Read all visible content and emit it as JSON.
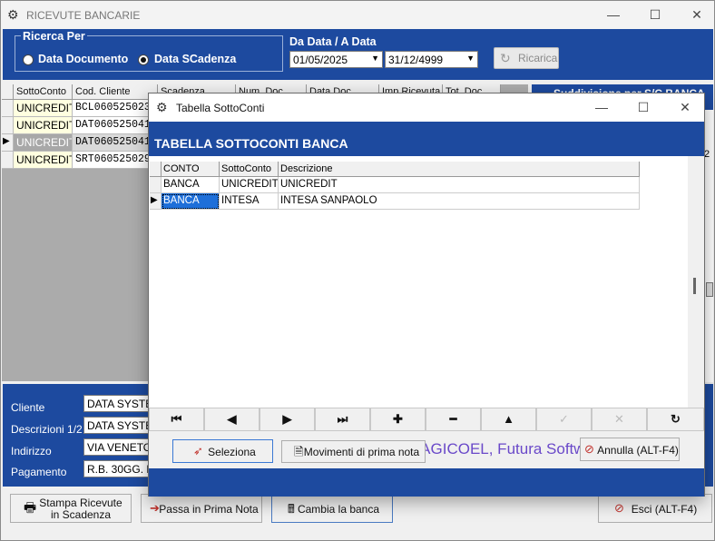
{
  "main": {
    "title": "RICEVUTE BANCARIE",
    "search": {
      "group_label": "Ricerca Per",
      "radio_documento": "Data Documento",
      "radio_scadenza": "Data SCadenza",
      "date_label": "Da Data / A Data",
      "date_from": "01/05/2025",
      "date_to": "31/12/4999",
      "reload_button": "Ricarica"
    },
    "grid": {
      "headers": [
        "SottoConto",
        "Cod. Cliente",
        "Scadenza",
        "Num. Doc.",
        "Data Doc.",
        "Imp.Ricevuta",
        "Tot. Doc."
      ],
      "rows": [
        {
          "sottoconto": "UNICREDIT",
          "cod": "BCL0605250232"
        },
        {
          "sottoconto": "UNICREDIT",
          "cod": "DAT060525041"
        },
        {
          "sottoconto": "UNICREDIT",
          "cod": "DAT060525041"
        },
        {
          "sottoconto": "UNICREDIT",
          "cod": "SRT060525029"
        }
      ]
    },
    "right_header": "Suddivisione per S/C BANCA",
    "right_cell": "2",
    "details": {
      "cliente_label": "Cliente",
      "cliente_value": "DATA SYSTE",
      "descr_label": "Descrizioni 1/2",
      "descr_value": "DATA SYSTE",
      "indirizzo_label": "Indirizzo",
      "indirizzo_value": "VIA VENETO,",
      "pagamento_label": "Pagamento",
      "pagamento_value": "R.B. 30GG. D"
    },
    "buttons": {
      "stampa_line1": "Stampa Ricevute",
      "stampa_line2": "in Scadenza",
      "passa": "Passa in Prima Nota",
      "cambia": "Cambia la banca",
      "esci": "Esci (ALT-F4)"
    }
  },
  "dialog": {
    "title": "Tabella SottoConti",
    "header": "TABELLA SOTTOCONTI BANCA",
    "columns": [
      "CONTO",
      "SottoConto",
      "Descrizione"
    ],
    "rows": [
      {
        "conto": "BANCA",
        "sottoconto": "UNICREDIT",
        "descrizione": "UNICREDIT"
      },
      {
        "conto": "BANCA",
        "sottoconto": "INTESA",
        "descrizione": "INTESA SANPAOLO"
      }
    ],
    "watermark": "MAGICOEL, Futura Software Fabriano",
    "buttons": {
      "seleziona": "Seleziona",
      "movimenti": "Movimenti di prima nota",
      "annulla": "Annulla (ALT-F4)"
    }
  }
}
